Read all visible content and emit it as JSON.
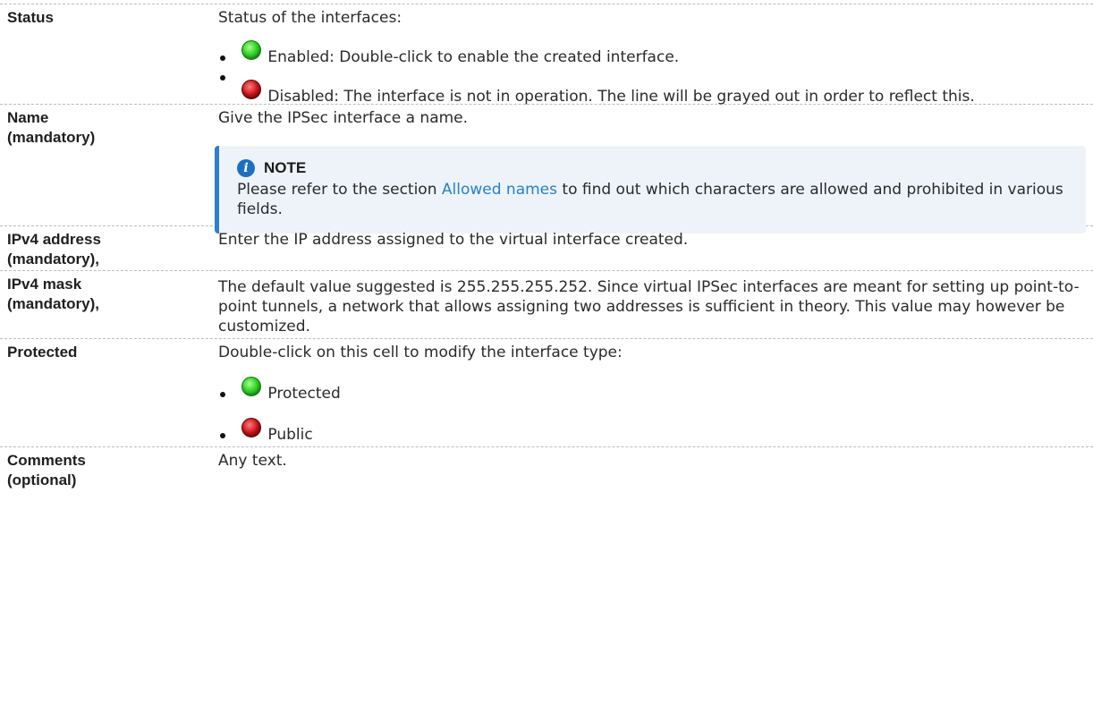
{
  "rows": {
    "status": {
      "label": "Status",
      "intro": "Status of the interfaces:",
      "items": [
        {
          "icon": "green-led-icon",
          "text": "Enabled: Double-click to enable the created interface."
        },
        {
          "icon": "red-led-icon",
          "text": "Disabled: The interface is not in operation. The line will be grayed out in order to reflect this."
        }
      ]
    },
    "name": {
      "label_line1": "Name",
      "label_line2": "(mandatory)",
      "text": "Give the IPSec interface a name.",
      "note": {
        "title": "NOTE",
        "before": "Please refer to the section ",
        "link": "Allowed names",
        "after": " to find out which characters are allowed and prohibited in various fields."
      }
    },
    "ipv4_address": {
      "label_line1": "IPv4 address",
      "label_line2": "(mandatory),",
      "text": "Enter the IP address assigned to the virtual interface created."
    },
    "ipv4_mask": {
      "label_line1": "IPv4 mask",
      "label_line2": "(mandatory),",
      "text": "The default value suggested is 255.255.255.252. Since virtual IPSec interfaces are meant for setting up point-to-point tunnels, a network that allows assigning two addresses is sufficient in theory. This value may however be customized."
    },
    "protected": {
      "label": "Protected",
      "intro": "Double-click on this cell to modify the interface type:",
      "items": [
        {
          "icon": "green-led-icon",
          "text": "Protected"
        },
        {
          "icon": "red-led-icon",
          "text": "Public"
        }
      ]
    },
    "comments": {
      "label_line1": "Comments",
      "label_line2": "(optional)",
      "text": "Any text."
    }
  },
  "colors": {
    "note_bg": "#eef3fa",
    "note_border": "#2a7fcf",
    "link": "#2680cc",
    "led_green": "#33d42a",
    "led_red": "#c8141a"
  }
}
